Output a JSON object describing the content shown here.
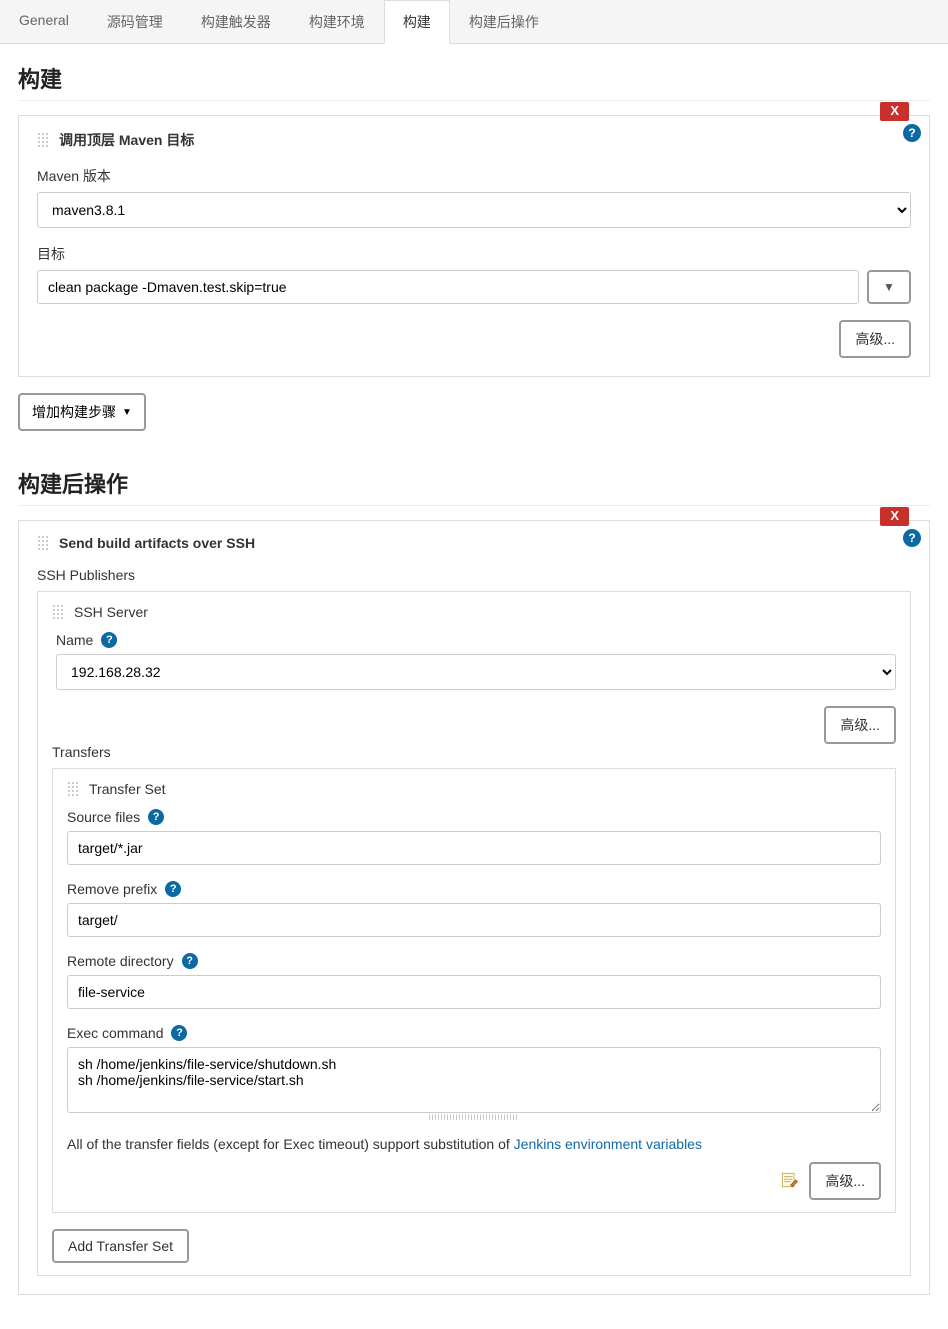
{
  "tabs": {
    "general": "General",
    "scm": "源码管理",
    "triggers": "构建触发器",
    "env": "构建环境",
    "build": "构建",
    "post": "构建后操作"
  },
  "active_tab": "构建",
  "build_section": {
    "title": "构建",
    "step_title": "调用顶层 Maven 目标",
    "delete_label": "X",
    "maven_version_label": "Maven 版本",
    "maven_version_value": "maven3.8.1",
    "goal_label": "目标",
    "goal_value": "clean package -Dmaven.test.skip=true",
    "advanced_label": "高级...",
    "add_step_label": "增加构建步骤"
  },
  "post_section": {
    "title": "构建后操作",
    "step_title": "Send build artifacts over SSH",
    "delete_label": "X",
    "publishers_label": "SSH Publishers",
    "server_label": "SSH Server",
    "name_label": "Name",
    "name_value": "192.168.28.32",
    "advanced_label": "高级...",
    "transfers_label": "Transfers",
    "transfer_set_label": "Transfer Set",
    "source_files_label": "Source files",
    "source_files_value": "target/*.jar",
    "remove_prefix_label": "Remove prefix",
    "remove_prefix_value": "target/",
    "remote_dir_label": "Remote directory",
    "remote_dir_value": "file-service",
    "exec_label": "Exec command",
    "exec_value": "sh /home/jenkins/file-service/shutdown.sh\nsh /home/jenkins/file-service/start.sh",
    "info_text_prefix": "All of the transfer fields (except for Exec timeout) support substitution of ",
    "info_link": "Jenkins environment variables",
    "add_transfer_label": "Add Transfer Set"
  }
}
